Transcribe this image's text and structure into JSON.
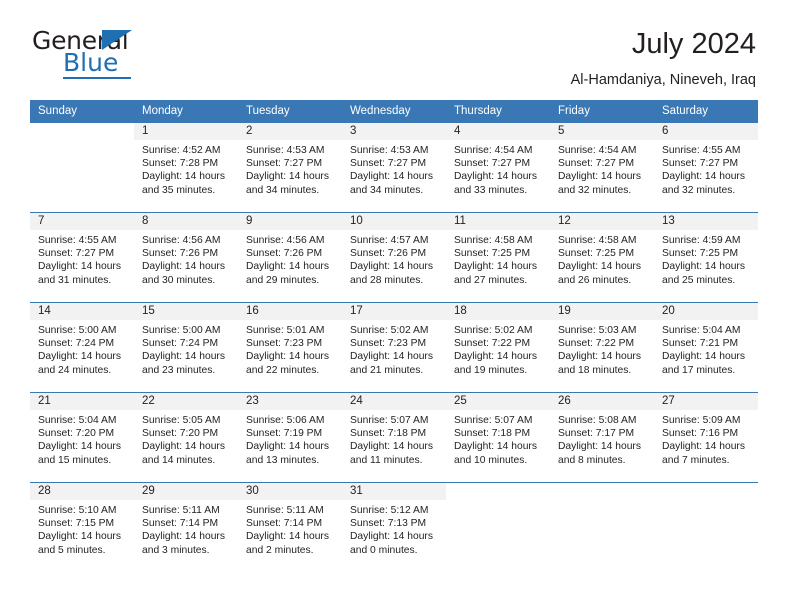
{
  "logo": {
    "word1": "General",
    "word2": "Blue",
    "triangle_color": "#1f6fb2",
    "text_color": "#231f20"
  },
  "header": {
    "title": "July 2024",
    "location": "Al-Hamdaniya, Nineveh, Iraq"
  },
  "theme": {
    "header_blue": "#3a77b5",
    "day_band_gray": "#f2f2f2",
    "text": "#231f20"
  },
  "calendar": {
    "weekday_headers": [
      "Sunday",
      "Monday",
      "Tuesday",
      "Wednesday",
      "Thursday",
      "Friday",
      "Saturday"
    ],
    "weeks": [
      [
        {
          "day": "",
          "lines": []
        },
        {
          "day": "1",
          "lines": [
            "Sunrise: 4:52 AM",
            "Sunset: 7:28 PM",
            "Daylight: 14 hours",
            "and 35 minutes."
          ]
        },
        {
          "day": "2",
          "lines": [
            "Sunrise: 4:53 AM",
            "Sunset: 7:27 PM",
            "Daylight: 14 hours",
            "and 34 minutes."
          ]
        },
        {
          "day": "3",
          "lines": [
            "Sunrise: 4:53 AM",
            "Sunset: 7:27 PM",
            "Daylight: 14 hours",
            "and 34 minutes."
          ]
        },
        {
          "day": "4",
          "lines": [
            "Sunrise: 4:54 AM",
            "Sunset: 7:27 PM",
            "Daylight: 14 hours",
            "and 33 minutes."
          ]
        },
        {
          "day": "5",
          "lines": [
            "Sunrise: 4:54 AM",
            "Sunset: 7:27 PM",
            "Daylight: 14 hours",
            "and 32 minutes."
          ]
        },
        {
          "day": "6",
          "lines": [
            "Sunrise: 4:55 AM",
            "Sunset: 7:27 PM",
            "Daylight: 14 hours",
            "and 32 minutes."
          ]
        }
      ],
      [
        {
          "day": "7",
          "lines": [
            "Sunrise: 4:55 AM",
            "Sunset: 7:27 PM",
            "Daylight: 14 hours",
            "and 31 minutes."
          ]
        },
        {
          "day": "8",
          "lines": [
            "Sunrise: 4:56 AM",
            "Sunset: 7:26 PM",
            "Daylight: 14 hours",
            "and 30 minutes."
          ]
        },
        {
          "day": "9",
          "lines": [
            "Sunrise: 4:56 AM",
            "Sunset: 7:26 PM",
            "Daylight: 14 hours",
            "and 29 minutes."
          ]
        },
        {
          "day": "10",
          "lines": [
            "Sunrise: 4:57 AM",
            "Sunset: 7:26 PM",
            "Daylight: 14 hours",
            "and 28 minutes."
          ]
        },
        {
          "day": "11",
          "lines": [
            "Sunrise: 4:58 AM",
            "Sunset: 7:25 PM",
            "Daylight: 14 hours",
            "and 27 minutes."
          ]
        },
        {
          "day": "12",
          "lines": [
            "Sunrise: 4:58 AM",
            "Sunset: 7:25 PM",
            "Daylight: 14 hours",
            "and 26 minutes."
          ]
        },
        {
          "day": "13",
          "lines": [
            "Sunrise: 4:59 AM",
            "Sunset: 7:25 PM",
            "Daylight: 14 hours",
            "and 25 minutes."
          ]
        }
      ],
      [
        {
          "day": "14",
          "lines": [
            "Sunrise: 5:00 AM",
            "Sunset: 7:24 PM",
            "Daylight: 14 hours",
            "and 24 minutes."
          ]
        },
        {
          "day": "15",
          "lines": [
            "Sunrise: 5:00 AM",
            "Sunset: 7:24 PM",
            "Daylight: 14 hours",
            "and 23 minutes."
          ]
        },
        {
          "day": "16",
          "lines": [
            "Sunrise: 5:01 AM",
            "Sunset: 7:23 PM",
            "Daylight: 14 hours",
            "and 22 minutes."
          ]
        },
        {
          "day": "17",
          "lines": [
            "Sunrise: 5:02 AM",
            "Sunset: 7:23 PM",
            "Daylight: 14 hours",
            "and 21 minutes."
          ]
        },
        {
          "day": "18",
          "lines": [
            "Sunrise: 5:02 AM",
            "Sunset: 7:22 PM",
            "Daylight: 14 hours",
            "and 19 minutes."
          ]
        },
        {
          "day": "19",
          "lines": [
            "Sunrise: 5:03 AM",
            "Sunset: 7:22 PM",
            "Daylight: 14 hours",
            "and 18 minutes."
          ]
        },
        {
          "day": "20",
          "lines": [
            "Sunrise: 5:04 AM",
            "Sunset: 7:21 PM",
            "Daylight: 14 hours",
            "and 17 minutes."
          ]
        }
      ],
      [
        {
          "day": "21",
          "lines": [
            "Sunrise: 5:04 AM",
            "Sunset: 7:20 PM",
            "Daylight: 14 hours",
            "and 15 minutes."
          ]
        },
        {
          "day": "22",
          "lines": [
            "Sunrise: 5:05 AM",
            "Sunset: 7:20 PM",
            "Daylight: 14 hours",
            "and 14 minutes."
          ]
        },
        {
          "day": "23",
          "lines": [
            "Sunrise: 5:06 AM",
            "Sunset: 7:19 PM",
            "Daylight: 14 hours",
            "and 13 minutes."
          ]
        },
        {
          "day": "24",
          "lines": [
            "Sunrise: 5:07 AM",
            "Sunset: 7:18 PM",
            "Daylight: 14 hours",
            "and 11 minutes."
          ]
        },
        {
          "day": "25",
          "lines": [
            "Sunrise: 5:07 AM",
            "Sunset: 7:18 PM",
            "Daylight: 14 hours",
            "and 10 minutes."
          ]
        },
        {
          "day": "26",
          "lines": [
            "Sunrise: 5:08 AM",
            "Sunset: 7:17 PM",
            "Daylight: 14 hours",
            "and 8 minutes."
          ]
        },
        {
          "day": "27",
          "lines": [
            "Sunrise: 5:09 AM",
            "Sunset: 7:16 PM",
            "Daylight: 14 hours",
            "and 7 minutes."
          ]
        }
      ],
      [
        {
          "day": "28",
          "lines": [
            "Sunrise: 5:10 AM",
            "Sunset: 7:15 PM",
            "Daylight: 14 hours",
            "and 5 minutes."
          ]
        },
        {
          "day": "29",
          "lines": [
            "Sunrise: 5:11 AM",
            "Sunset: 7:14 PM",
            "Daylight: 14 hours",
            "and 3 minutes."
          ]
        },
        {
          "day": "30",
          "lines": [
            "Sunrise: 5:11 AM",
            "Sunset: 7:14 PM",
            "Daylight: 14 hours",
            "and 2 minutes."
          ]
        },
        {
          "day": "31",
          "lines": [
            "Sunrise: 5:12 AM",
            "Sunset: 7:13 PM",
            "Daylight: 14 hours",
            "and 0 minutes."
          ]
        },
        {
          "day": "",
          "lines": []
        },
        {
          "day": "",
          "lines": []
        },
        {
          "day": "",
          "lines": []
        }
      ]
    ]
  }
}
